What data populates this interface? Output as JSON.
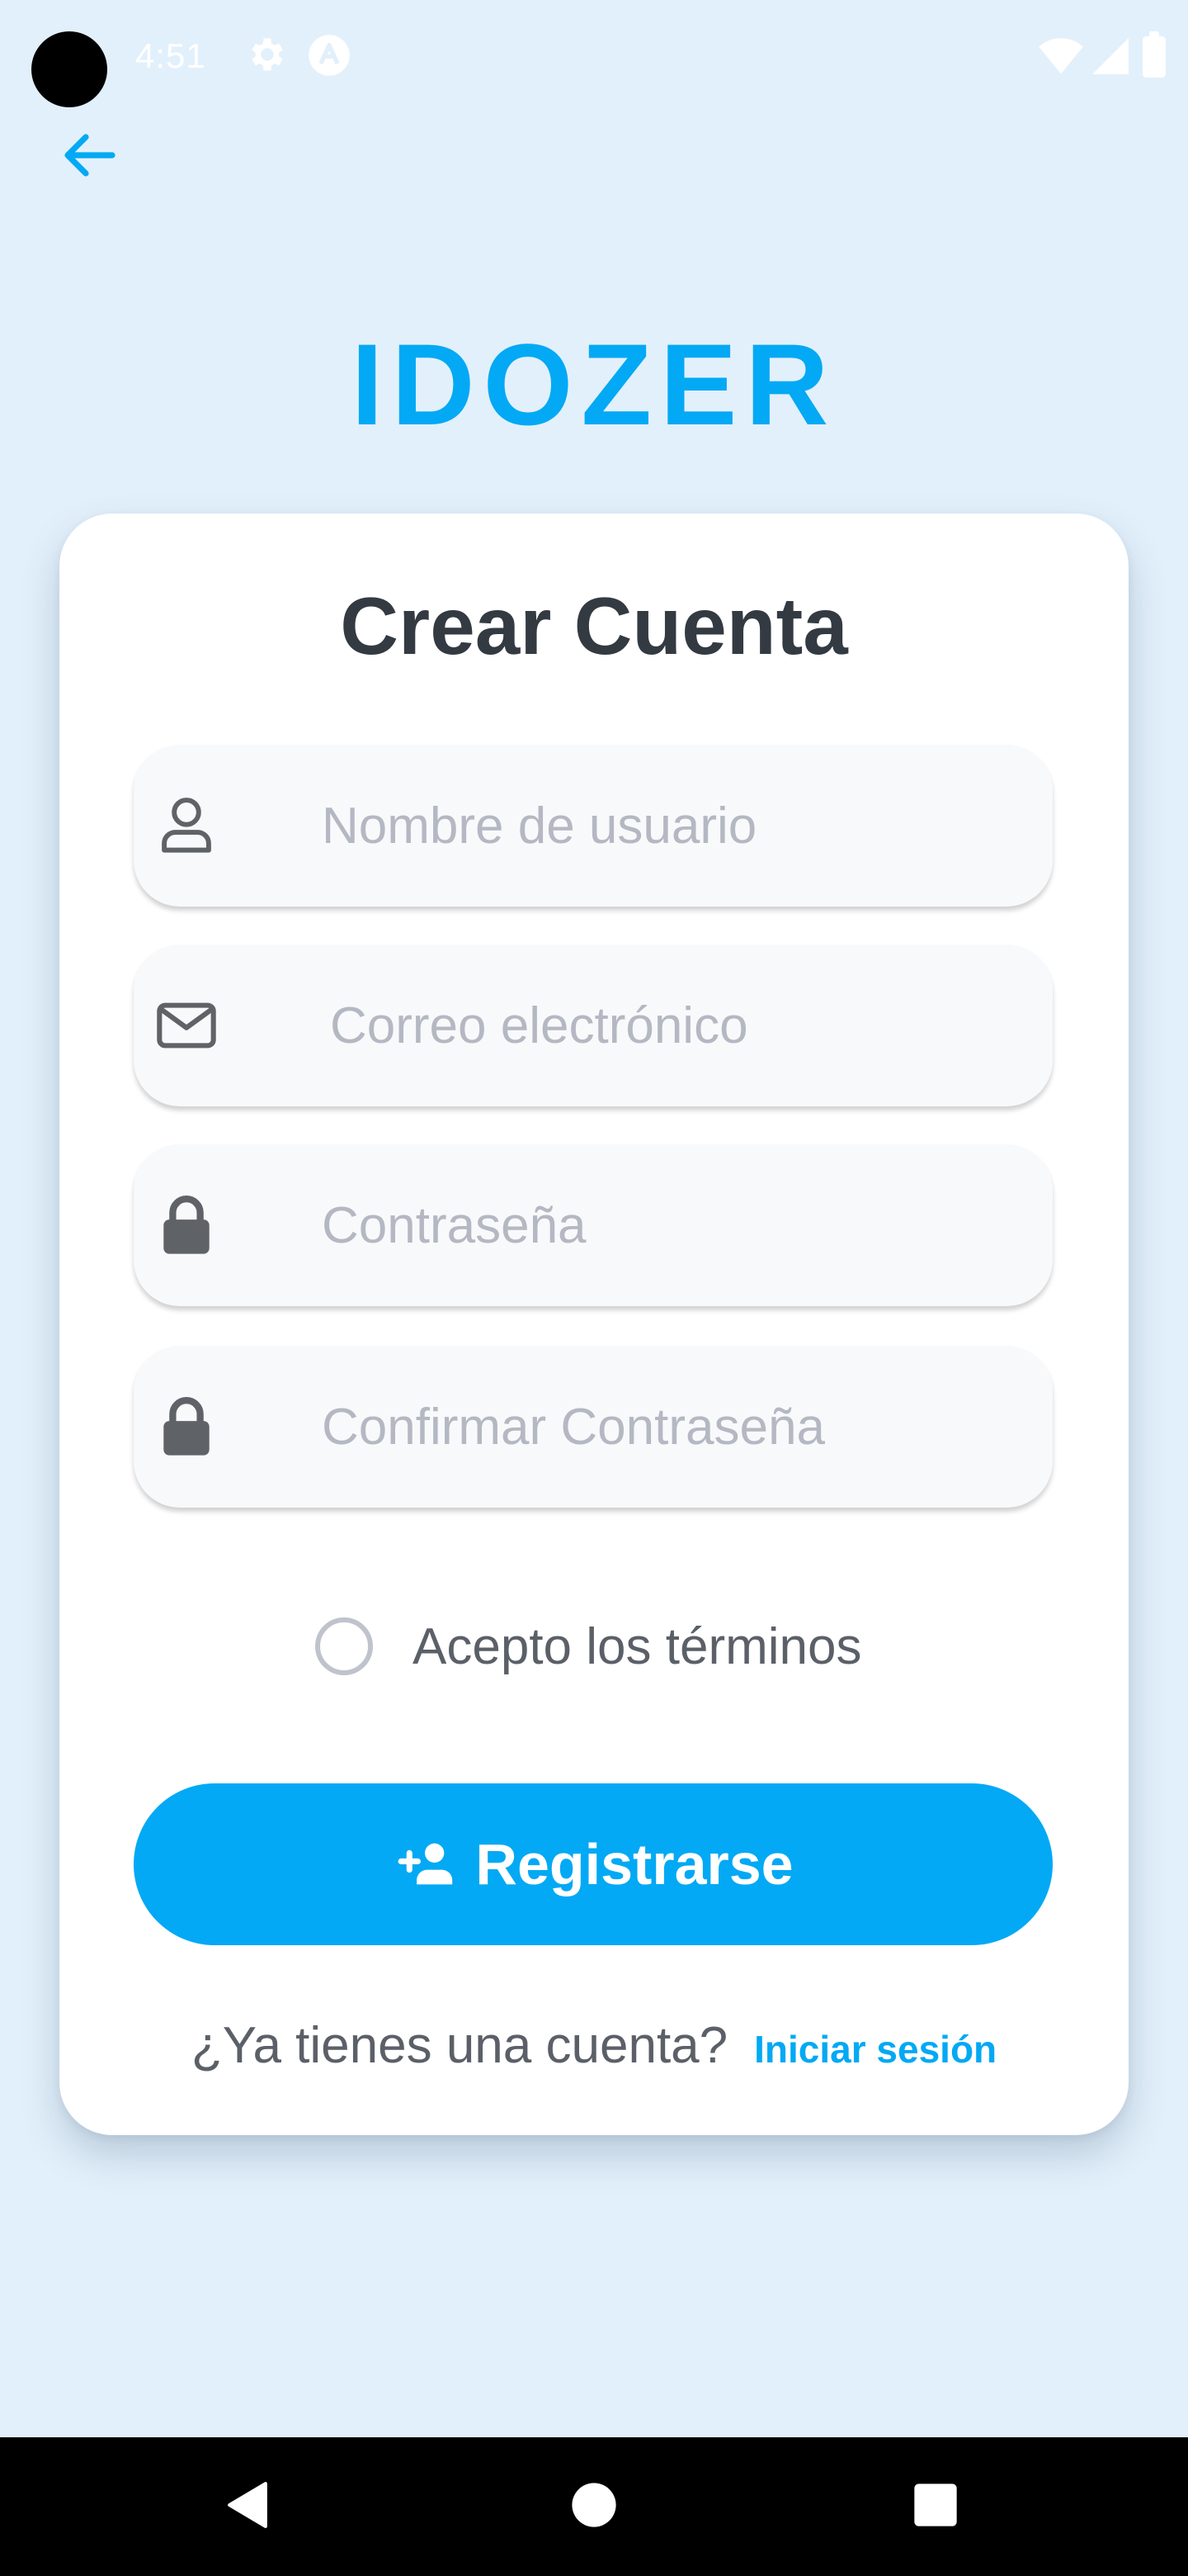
{
  "status_bar": {
    "time": "4:51",
    "icons": [
      "settings-icon",
      "a-badge-icon",
      "wifi-icon",
      "signal-icon",
      "battery-icon"
    ]
  },
  "header": {
    "back_icon": "arrow-left-icon",
    "logo": "IDOZER"
  },
  "form": {
    "title": "Crear Cuenta",
    "fields": [
      {
        "icon": "user-icon",
        "placeholder": "Nombre de usuario",
        "value": ""
      },
      {
        "icon": "envelope-icon",
        "placeholder": "Correo electrónico",
        "value": ""
      },
      {
        "icon": "lock-icon",
        "placeholder": "Contraseña",
        "value": ""
      },
      {
        "icon": "lock-icon",
        "placeholder": "Confirmar Contraseña",
        "value": ""
      }
    ],
    "terms_label": "Acepto los términos",
    "terms_checked": false,
    "register_label": "Registrarse",
    "register_icon": "person-add-icon",
    "login_question": "¿Ya tienes una cuenta?",
    "login_link": "Iniciar sesión"
  },
  "colors": {
    "background": "#e2f0fb",
    "accent": "#03a9f4",
    "title_text": "#333a42",
    "placeholder": "#b4b8c2"
  },
  "nav_bar": {
    "buttons": [
      "back-triangle-icon",
      "home-circle-icon",
      "recents-square-icon"
    ]
  }
}
